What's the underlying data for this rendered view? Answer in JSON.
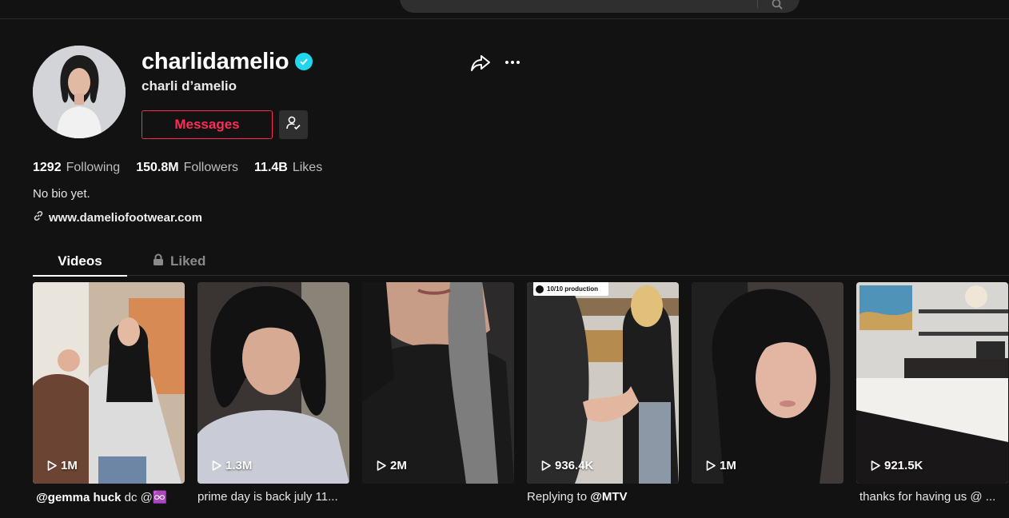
{
  "profile": {
    "username": "charlidamelio",
    "nickname": "charli d’amelio",
    "messages_label": "Messages",
    "bio": "No bio yet.",
    "link": "www.dameliofootwear.com"
  },
  "stats": [
    {
      "value": "1292",
      "label": "Following"
    },
    {
      "value": "150.8M",
      "label": "Followers"
    },
    {
      "value": "11.4B",
      "label": "Likes"
    }
  ],
  "tabs": {
    "videos": "Videos",
    "liked": "Liked"
  },
  "videos": [
    {
      "views": "1M",
      "caption_pre": "",
      "caption_bold": "@gemma huck",
      "caption_post": " dc @♾️"
    },
    {
      "views": "1.3M",
      "caption_pre": "prime day is back july 11...",
      "caption_bold": "",
      "caption_post": ""
    },
    {
      "views": "2M",
      "caption_pre": "",
      "caption_bold": "",
      "caption_post": ""
    },
    {
      "views": "936.4K",
      "caption_pre": "Replying to ",
      "caption_bold": "@MTV",
      "caption_post": "",
      "badge": "10/10 production"
    },
    {
      "views": "1M",
      "caption_pre": "",
      "caption_bold": "",
      "caption_post": ""
    },
    {
      "views": "921.5K",
      "caption_pre": "thanks for having us @ ...",
      "caption_bold": "",
      "caption_post": ""
    }
  ],
  "colors": {
    "background": "#121212",
    "accent": "#fe2c55",
    "verified": "#20d5ec"
  },
  "icons": {
    "verified": "verified-check-icon",
    "friend": "person-check-icon",
    "share": "share-arrow-icon",
    "more": "more-dots-icon",
    "link": "link-icon",
    "lock": "lock-icon",
    "play": "play-icon",
    "search": "search-icon"
  }
}
